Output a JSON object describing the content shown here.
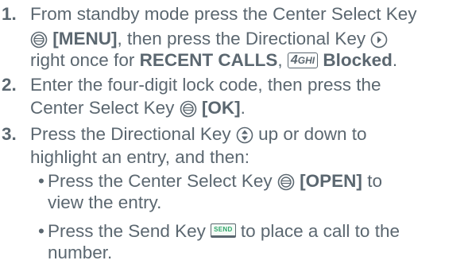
{
  "steps": [
    {
      "number": "1.",
      "line1_a": "From standby mode press the Center Select Key",
      "line2_menu": "[MENU]",
      "line2_b": ", then press the Directional Key",
      "line3_a": "right once for",
      "line3_recent": "RECENT CALLS",
      "line3_comma": ",",
      "line3_key_digit": "4",
      "line3_key_letters": "GHI",
      "line3_blocked": "Blocked",
      "line3_end": "."
    },
    {
      "number": "2.",
      "line1": "Enter the four-digit lock code, then press the",
      "line2_a": "Center Select Key",
      "line2_ok": "[OK]",
      "line2_end": "."
    },
    {
      "number": "3.",
      "line1_a": "Press the Directional Key",
      "line1_b": "up or down to",
      "line2": "highlight an entry, and then:",
      "bullets": [
        {
          "dot": "•",
          "line1_a": "Press the Center Select Key",
          "line1_open": "[OPEN]",
          "line1_b": "to",
          "line2": "view the entry."
        },
        {
          "dot": "•",
          "line1_a": "Press the Send Key",
          "send_label": "SEND",
          "line1_b": "to place a call to the",
          "line2": "number."
        }
      ]
    }
  ],
  "icons": {
    "center_select": "center-select-key-icon",
    "directional_right": "directional-right-key-icon",
    "directional_updown": "directional-updown-key-icon",
    "keypad_4": "keypad-4-ghi-icon",
    "send": "send-key-icon"
  },
  "colors": {
    "text": "#5b6770",
    "send_green": "#2fa56a"
  }
}
